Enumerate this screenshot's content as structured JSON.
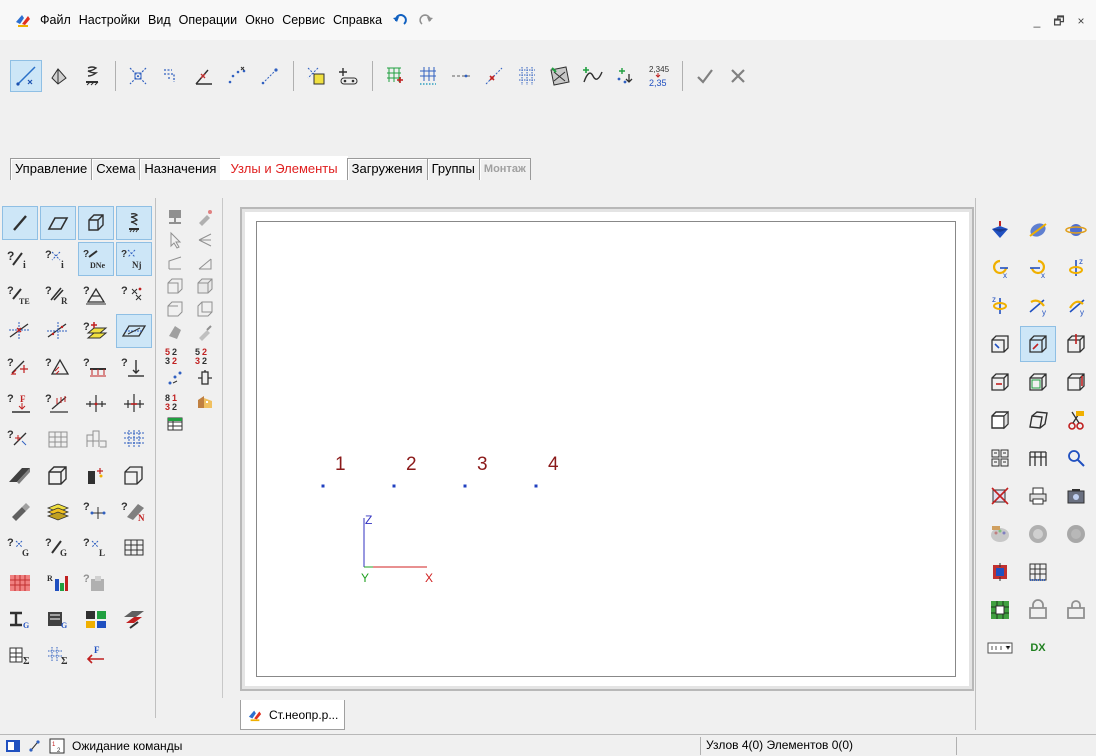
{
  "menu": {
    "items": [
      "Файл",
      "Настройки",
      "Вид",
      "Операции",
      "Окно",
      "Сервис",
      "Справка"
    ]
  },
  "window_controls": [
    "_",
    "🗗",
    "×"
  ],
  "tabs": [
    {
      "label": "Управление",
      "state": "normal"
    },
    {
      "label": "Схема",
      "state": "normal"
    },
    {
      "label": "Назначения",
      "state": "normal"
    },
    {
      "label": "Узлы и Элементы",
      "state": "active"
    },
    {
      "label": "Загружения",
      "state": "normal"
    },
    {
      "label": "Группы",
      "state": "normal"
    },
    {
      "label": "Монтаж",
      "state": "disabled"
    }
  ],
  "toolbar": {
    "buttons": [
      "add-node-icon",
      "move-node-icon",
      "node-support-icon",
      "delete-node-icon",
      "merge-nodes-icon",
      "divide-line-icon",
      "arc-nodes-icon",
      "node-coords-icon",
      "select-node-icon",
      "connect-elements-icon",
      "grid-generate-icon",
      "grid-points-icon",
      "dashed-line-icon",
      "cross-node-icon",
      "hatched-grid-icon",
      "surface-icon",
      "curve-icon",
      "node-number-icon",
      "numbering-icon",
      "apply-icon",
      "cancel-icon"
    ],
    "numbering_top": "2,345",
    "numbering_bottom": "2,35"
  },
  "canvas": {
    "nodes": [
      {
        "label": "1"
      },
      {
        "label": "2"
      },
      {
        "label": "3"
      },
      {
        "label": "4"
      }
    ],
    "axes": {
      "z": "Z",
      "y": "Y",
      "x": "X"
    }
  },
  "right_panel": {
    "dx_label": "DX"
  },
  "doc_tab": {
    "label": "Ст.неопр.р..."
  },
  "status": {
    "left": "Ожидание команды",
    "right": "Узлов 4(0) Элементов 0(0)"
  },
  "colors": {
    "active_tab": "#e02020",
    "node_label": "#8b1a1a",
    "node_point": "#2040c0",
    "axis_z": "#3030c0",
    "axis_y": "#20a020",
    "axis_x": "#d02020"
  }
}
